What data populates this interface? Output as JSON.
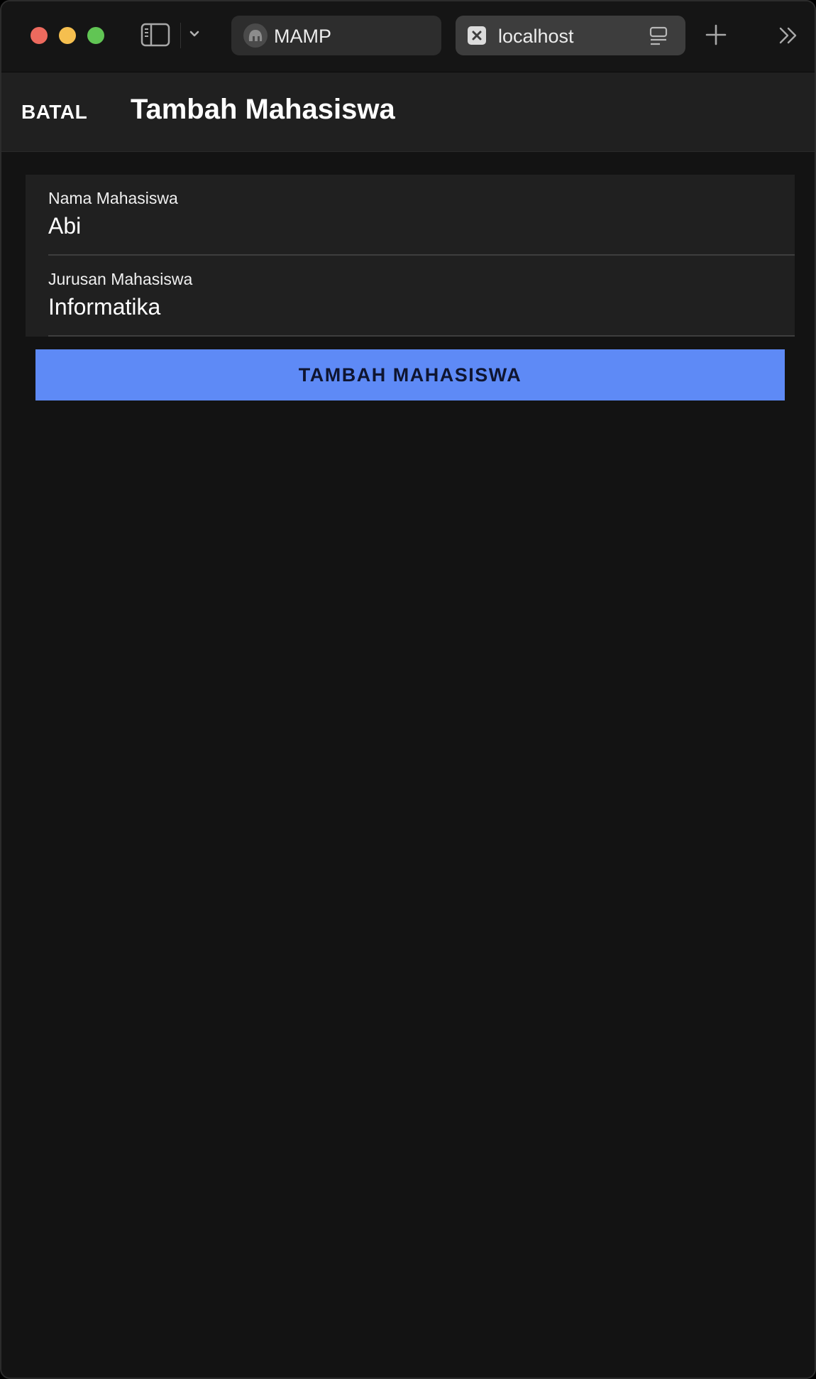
{
  "browser": {
    "tabs": [
      {
        "label": "MAMP",
        "icon": "mamp-elephant-icon",
        "active": false
      },
      {
        "label": "localhost",
        "icon": "close-icon",
        "active": true
      }
    ]
  },
  "app": {
    "cancel_label": "BATAL",
    "title": "Tambah Mahasiswa"
  },
  "form": {
    "fields": [
      {
        "label": "Nama Mahasiswa",
        "value": "Abi"
      },
      {
        "label": "Jurusan Mahasiswa",
        "value": "Informatika"
      }
    ],
    "submit_label": "TAMBAH MAHASISWA"
  },
  "colors": {
    "accent": "#5e8af6",
    "background": "#131313",
    "surface": "#202020"
  }
}
